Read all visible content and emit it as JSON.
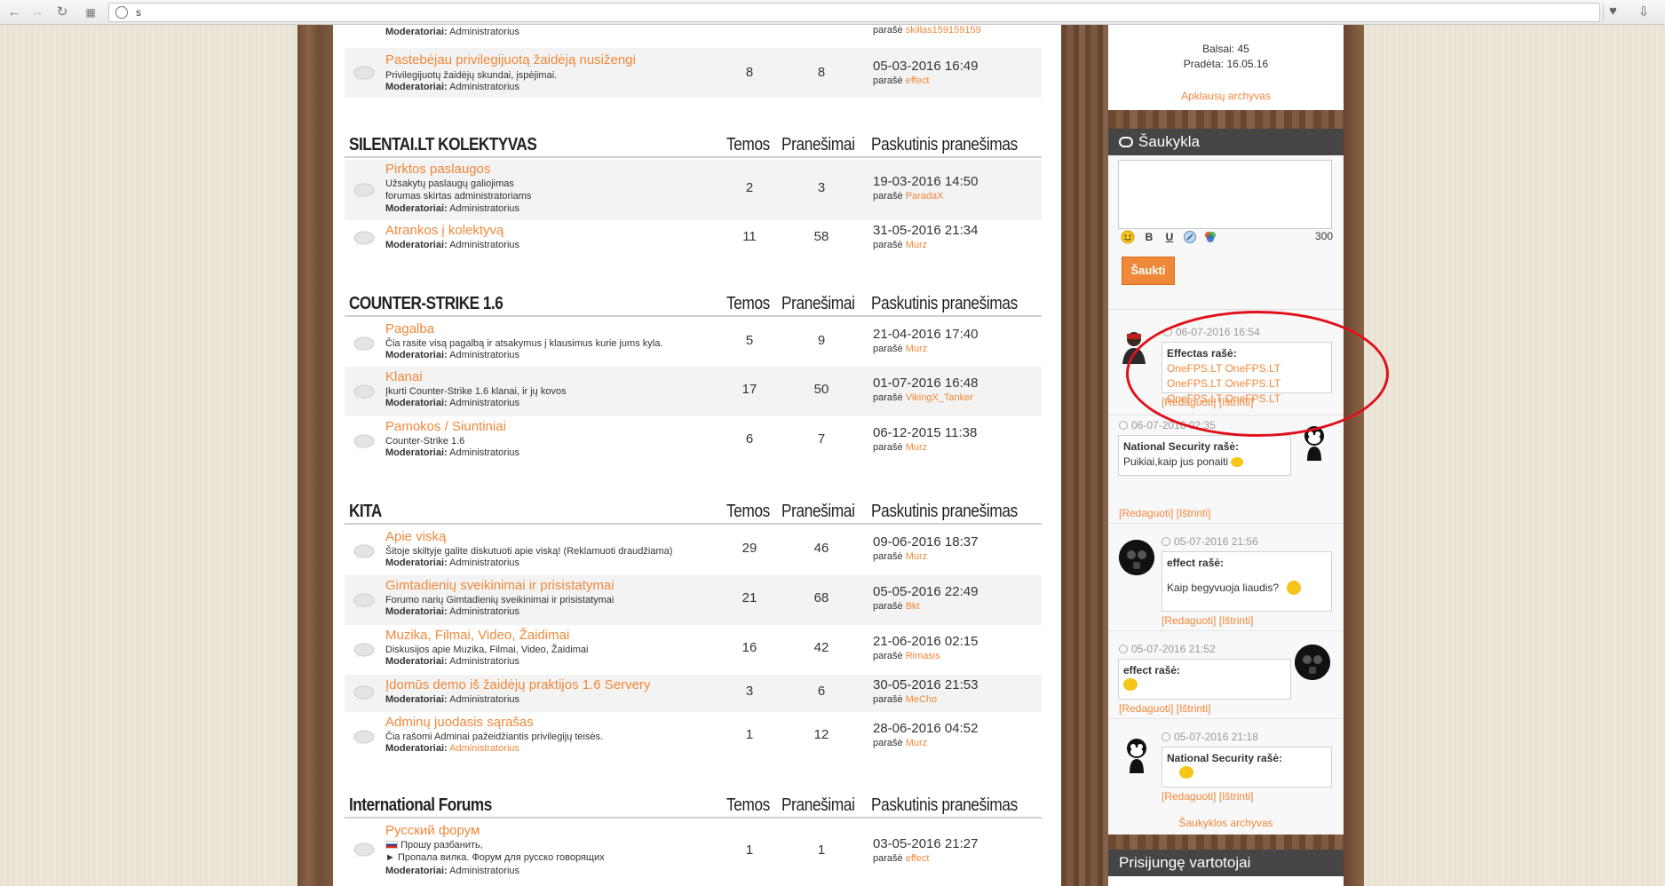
{
  "browser": {
    "back_icon": "arrow-left-icon",
    "address": "s"
  },
  "forum": {
    "categories": [
      {
        "title": "SILENTAI.LT KOLEKTYVAS",
        "col_topics": "Temos",
        "col_posts": "Pranešimai",
        "col_last": "Paskutinis pranešimas"
      },
      {
        "title": "COUNTER-STRIKE 1.6",
        "col_topics": "Temos",
        "col_posts": "Pranešimai",
        "col_last": "Paskutinis pranešimas"
      },
      {
        "title": "KITA",
        "col_topics": "Temos",
        "col_posts": "Pranešimai",
        "col_last": "Paskutinis pranešimas"
      },
      {
        "title": "International Forums",
        "col_topics": "Temos",
        "col_posts": "Pranešimai",
        "col_last": "Paskutinis pranešimas"
      }
    ],
    "moderators_label": "Moderatoriai:",
    "moderators_value": "Administratorius",
    "wrote_label": "parašė",
    "rows": [
      {
        "title": "",
        "desc": "",
        "topics": "",
        "posts": "",
        "date": "",
        "author": "skillas159159159"
      },
      {
        "title": "Pastebėjau privilegijuotą žaidėją nusižengi",
        "desc": "Privilegijuotų žaidėjų skundai, įspėjimai.",
        "topics": "8",
        "posts": "8",
        "date": "05-03-2016 16:49",
        "author": "effect"
      },
      {
        "title": "Pirktos paslaugos",
        "desc": "Užsakytų paslaugų galiojimas",
        "desc2": "forumas skirtas administratoriams",
        "topics": "2",
        "posts": "3",
        "date": "19-03-2016 14:50",
        "author": "ParadaX"
      },
      {
        "title": "Atrankos į kolektyvą",
        "desc": "",
        "topics": "11",
        "posts": "58",
        "date": "31-05-2016 21:34",
        "author": "Murz"
      },
      {
        "title": "Pagalba",
        "desc": "Čia rasite visą pagalbą ir atsakymus į klausimus kurie jums kyla.",
        "topics": "5",
        "posts": "9",
        "date": "21-04-2016 17:40",
        "author": "Murz"
      },
      {
        "title": "Klanai",
        "desc": "Įkurti Counter-Strike 1.6 klanai, ir jų kovos",
        "topics": "17",
        "posts": "50",
        "date": "01-07-2016 16:48",
        "author": "VikingX_Tanker"
      },
      {
        "title": "Pamokos / Siuntiniai",
        "desc": "Counter-Strike 1.6",
        "topics": "6",
        "posts": "7",
        "date": "06-12-2015 11:38",
        "author": "Murz"
      },
      {
        "title": "Apie viską",
        "desc": "Šitoje skiltyje galite diskutuoti apie viską! (Reklamuoti draudžiama)",
        "topics": "29",
        "posts": "46",
        "date": "09-06-2016 18:37",
        "author": "Murz"
      },
      {
        "title": "Gimtadienių sveikinimai ir prisistatymai",
        "desc": "Forumo narių Gimtadienių sveikinimai ir prisistatymai",
        "topics": "21",
        "posts": "68",
        "date": "05-05-2016 22:49",
        "author": "Bkt"
      },
      {
        "title": "Muzika, Filmai, Video, Žaidimai",
        "desc": "Diskusijos apie Muzika, Filmai, Video, Žaidimai",
        "topics": "16",
        "posts": "42",
        "date": "21-06-2016 02:15",
        "author": "Rimasis"
      },
      {
        "title": "Įdomūs demo iš žaidėjų praktijos 1.6 Servery",
        "desc": "",
        "topics": "3",
        "posts": "6",
        "date": "30-05-2016 21:53",
        "author": "MeCho"
      },
      {
        "title": "Adminų juodasis sąrašas",
        "desc": "Čia rašomi Adminai pažeidžiantis privilegijų teisės.",
        "topics": "1",
        "posts": "12",
        "date": "28-06-2016 04:52",
        "author": "Murz"
      },
      {
        "title": "Русский форум",
        "desc": "Прошу разбанить,",
        "desc2": "► Пропала вилка. Форум для русско говорящих",
        "topics": "1",
        "posts": "1",
        "date": "03-05-2016 21:27",
        "author": "effect"
      }
    ]
  },
  "sidebar": {
    "poll": {
      "votes_label": "Balsai:",
      "votes_value": "45",
      "started_label": "Pradėta:",
      "started_value": "16.05.16",
      "archive_link": "Apklausų archyvas"
    },
    "shoutbox": {
      "title": "Šaukykla",
      "chars_left": "300",
      "submit_label": "Šaukti",
      "toolbar": [
        "B",
        "U"
      ],
      "edit_label": "[Redaguoti]",
      "delete_label": "[Ištrinti]",
      "archive_link": "Šaukyklos archyvas",
      "messages": [
        {
          "date": "06-07-2016 16:54",
          "author": "Effectas rašė:",
          "lines": [
            "OneFPS.LT OneFPS.LT",
            "OneFPS.LT OneFPS.LT",
            "OneFPS.LT OneFPS.LT"
          ]
        },
        {
          "date": "06-07-2016 02:35",
          "author": "National Security rašė:",
          "text": "Puikiai,kaip jus ponaiti"
        },
        {
          "date": "05-07-2016 21:56",
          "author": "effect rašė:",
          "text": "Kaip begyvuoja liaudis?"
        },
        {
          "date": "05-07-2016 21:52",
          "author": "effect rašė:",
          "text": ""
        },
        {
          "date": "05-07-2016 21:18",
          "author": "National Security rašė:",
          "text": ""
        }
      ]
    },
    "online": {
      "title": "Prisijungę vartotojai"
    }
  },
  "colors": {
    "accent": "#f0883a",
    "annotation": "#e0101a"
  }
}
